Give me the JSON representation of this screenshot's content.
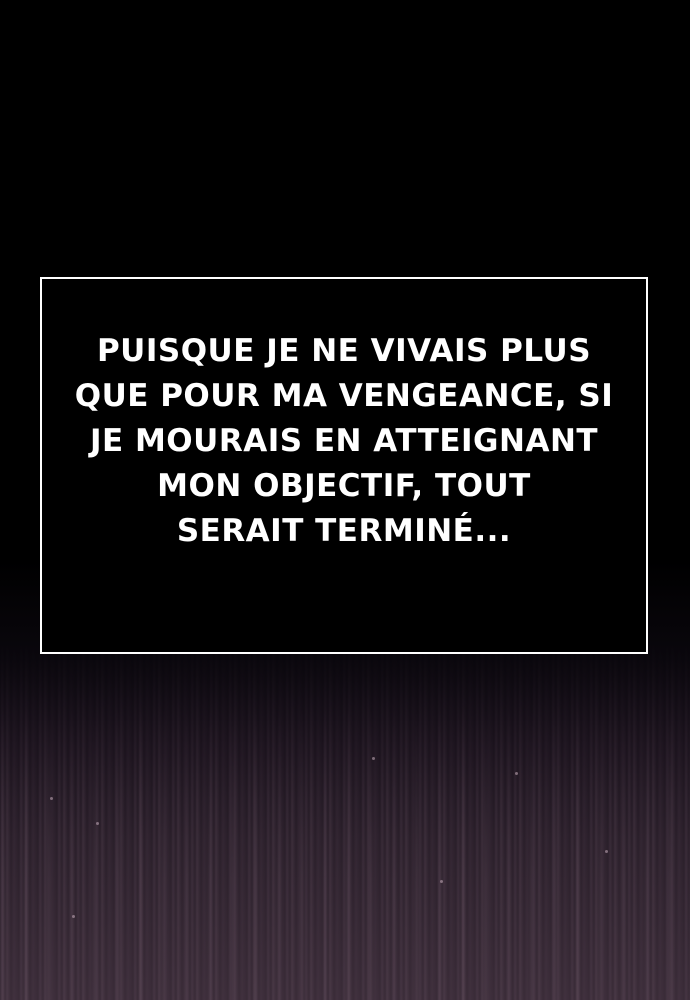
{
  "narration": {
    "lines": [
      "PUISQUE JE NE VIVAIS PLUS",
      "QUE POUR MA VENGEANCE, SI",
      "JE MOURAIS EN ATTEIGNANT",
      "MON OBJECTIF, TOUT",
      "SERAIT TERMINÉ..."
    ]
  },
  "colors": {
    "background": "#000000",
    "box_border": "#ffffff",
    "text": "#ffffff",
    "streak_tint": "#3a2c38"
  }
}
